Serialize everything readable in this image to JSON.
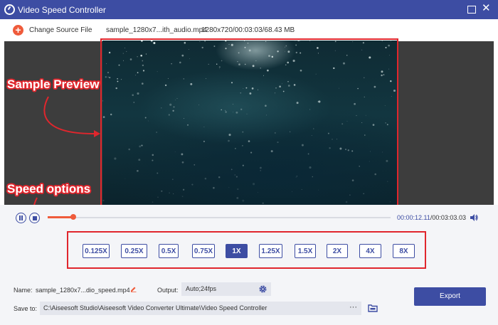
{
  "app": {
    "title": "Video Speed Controller"
  },
  "topbar": {
    "change_source": "Change Source File",
    "filename": "sample_1280x7...ith_audio.mp4",
    "fileinfo": "1280x720/00:03:03/68.43 MB"
  },
  "annotations": {
    "preview": "Sample Preview",
    "speed": "Speed options"
  },
  "player": {
    "current_time": "00:00:12.11",
    "total_time": "00:03:03.03",
    "progress_fraction": 0.075
  },
  "speeds": [
    {
      "label": "0.125X",
      "active": false
    },
    {
      "label": "0.25X",
      "active": false
    },
    {
      "label": "0.5X",
      "active": false
    },
    {
      "label": "0.75X",
      "active": false
    },
    {
      "label": "1X",
      "active": true
    },
    {
      "label": "1.25X",
      "active": false
    },
    {
      "label": "1.5X",
      "active": false
    },
    {
      "label": "2X",
      "active": false
    },
    {
      "label": "4X",
      "active": false
    },
    {
      "label": "8X",
      "active": false
    }
  ],
  "output_settings": {
    "name_label": "Name:",
    "name_value": "sample_1280x7...dio_speed.mp4",
    "output_label": "Output:",
    "output_value": "Auto;24fps",
    "save_label": "Save to:",
    "save_path": "C:\\Aiseesoft Studio\\Aiseesoft Video Converter Ultimate\\Video Speed Controller",
    "browse": "···",
    "export": "Export"
  },
  "colors": {
    "accent": "#3d4da3",
    "highlight": "#ef5b3b",
    "annotation": "#e0262d"
  }
}
